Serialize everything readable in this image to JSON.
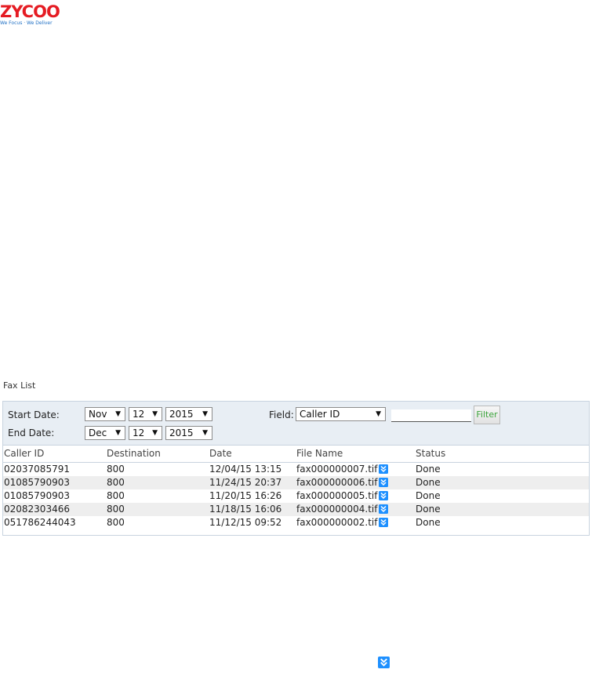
{
  "brand": {
    "logo_text": "ZYCOO",
    "tagline": "We Focus · We Deliver",
    "colors": {
      "red": "#e51c23",
      "blue": "#1e6fc4"
    }
  },
  "section_title": "Fax List",
  "filter": {
    "start_label": "Start Date:",
    "end_label": "End Date:",
    "start": {
      "month": "Nov",
      "day": "12",
      "year": "2015"
    },
    "end": {
      "month": "Dec",
      "day": "12",
      "year": "2015"
    },
    "field_label": "Field:",
    "field_value": "Caller ID",
    "search_value": "",
    "filter_button": "Filter"
  },
  "table": {
    "columns": [
      "Caller ID",
      "Destination",
      "Date",
      "File Name",
      "Status"
    ],
    "rows": [
      {
        "caller_id": "02037085791",
        "destination": "800",
        "date": "12/04/15 13:15",
        "file": "fax000000007.tif",
        "status": "Done"
      },
      {
        "caller_id": "01085790903",
        "destination": "800",
        "date": "11/24/15 20:37",
        "file": "fax000000006.tif",
        "status": "Done"
      },
      {
        "caller_id": "01085790903",
        "destination": "800",
        "date": "11/20/15 16:26",
        "file": "fax000000005.tif",
        "status": "Done"
      },
      {
        "caller_id": "02082303466",
        "destination": "800",
        "date": "11/18/15 16:06",
        "file": "fax000000004.tif",
        "status": "Done"
      },
      {
        "caller_id": "051786244043",
        "destination": "800",
        "date": "11/12/15 09:52",
        "file": "fax000000002.tif",
        "status": "Done"
      }
    ]
  },
  "icons": {
    "download": "download-icon"
  }
}
